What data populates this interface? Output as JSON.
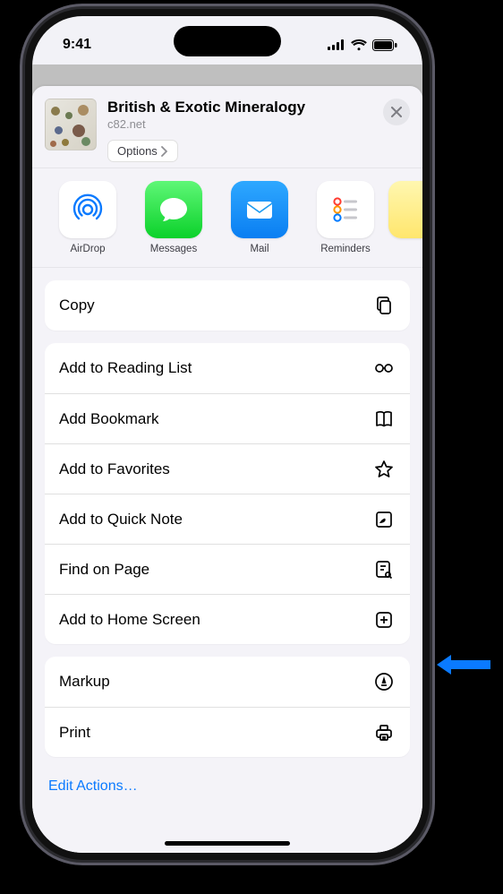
{
  "status": {
    "time": "9:41"
  },
  "header": {
    "title": "British & Exotic Mineralogy",
    "subtitle": "c82.net",
    "options_label": "Options"
  },
  "apps": [
    {
      "id": "airdrop",
      "label": "AirDrop"
    },
    {
      "id": "messages",
      "label": "Messages"
    },
    {
      "id": "mail",
      "label": "Mail"
    },
    {
      "id": "reminders",
      "label": "Reminders"
    }
  ],
  "groups": [
    [
      {
        "id": "copy",
        "label": "Copy",
        "icon": "copy"
      }
    ],
    [
      {
        "id": "reading-list",
        "label": "Add to Reading List",
        "icon": "glasses"
      },
      {
        "id": "bookmark",
        "label": "Add Bookmark",
        "icon": "book"
      },
      {
        "id": "favorites",
        "label": "Add to Favorites",
        "icon": "star"
      },
      {
        "id": "quick-note",
        "label": "Add to Quick Note",
        "icon": "quicknote"
      },
      {
        "id": "find",
        "label": "Find on Page",
        "icon": "find"
      },
      {
        "id": "homescreen",
        "label": "Add to Home Screen",
        "icon": "plus-square"
      }
    ],
    [
      {
        "id": "markup",
        "label": "Markup",
        "icon": "markup"
      },
      {
        "id": "print",
        "label": "Print",
        "icon": "print"
      }
    ]
  ],
  "edit_actions_label": "Edit Actions…"
}
